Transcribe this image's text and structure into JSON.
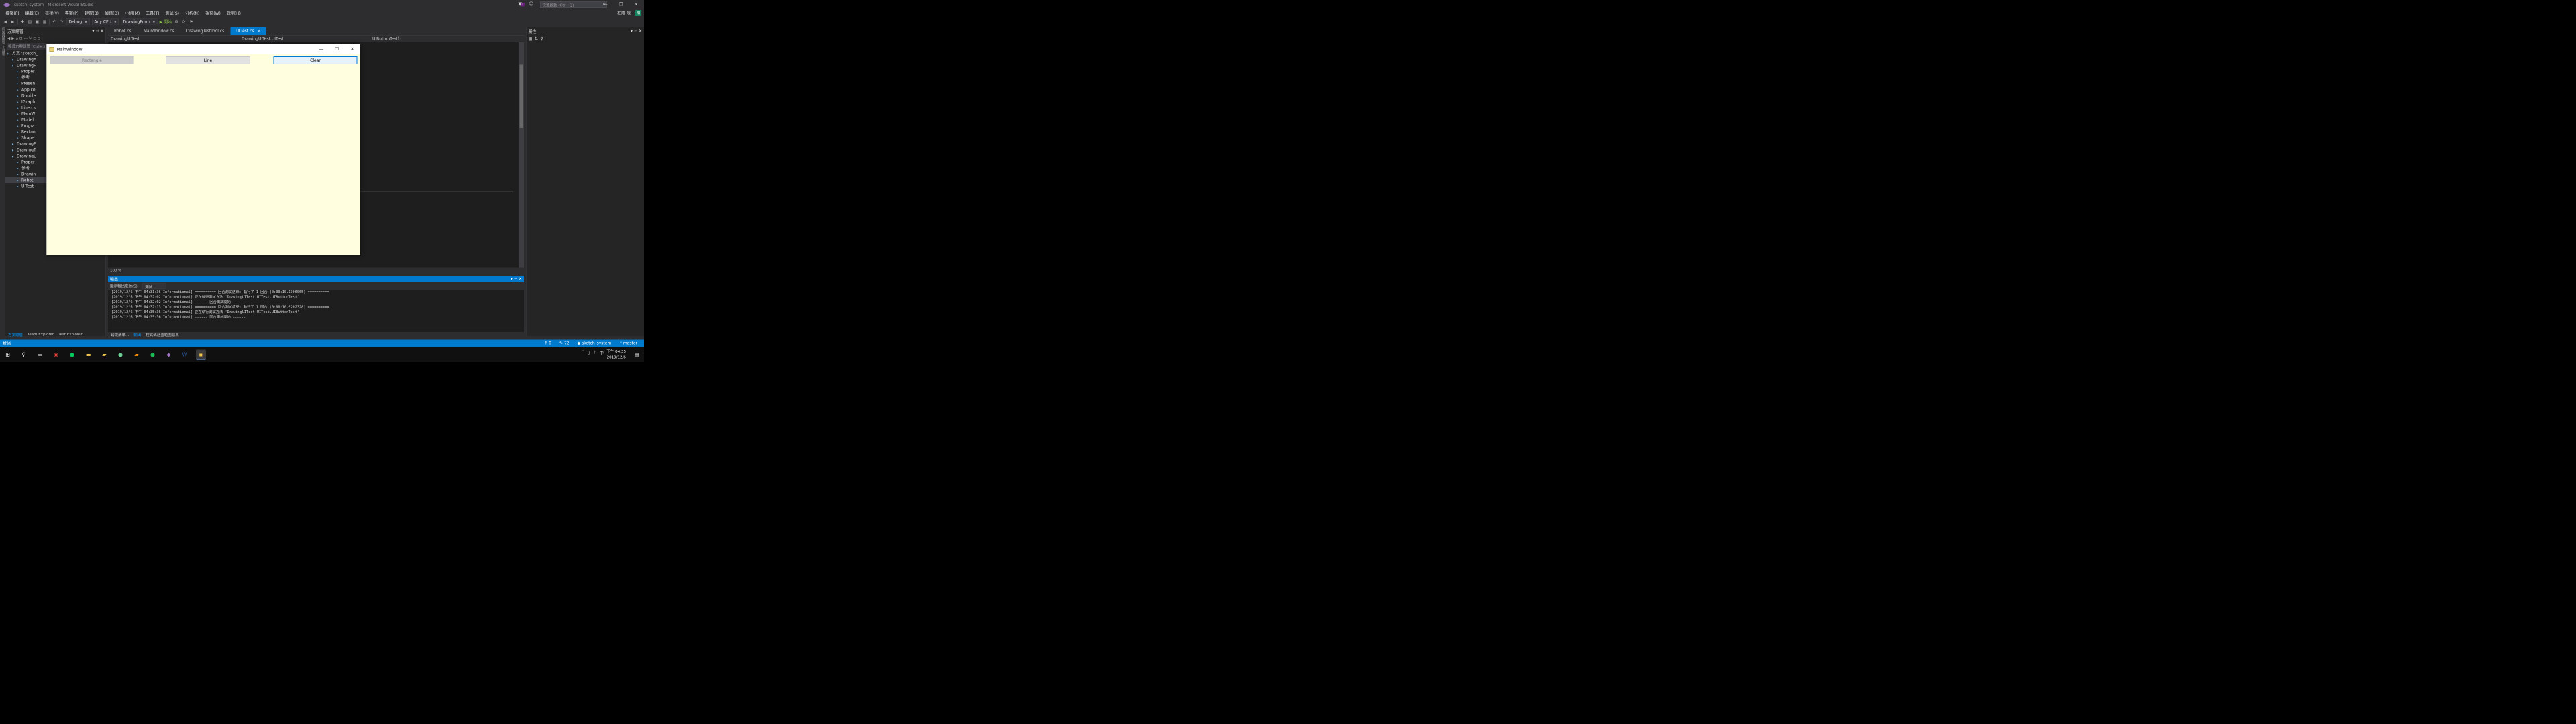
{
  "titlebar": {
    "title": "sketch_system - Microsoft Visual Studio",
    "search_placeholder": "快速啟動 (Ctrl+Q)",
    "notif_count": "1",
    "minimize": "—",
    "restore": "❐",
    "close": "✕"
  },
  "menus": [
    "檔案(F)",
    "編輯(E)",
    "檢視(V)",
    "專案(P)",
    "建置(B)",
    "偵錯(D)",
    "小組(M)",
    "工具(T)",
    "測試(S)",
    "分析(N)",
    "視窗(W)",
    "說明(H)"
  ],
  "user": {
    "name": "柏隆 陳",
    "initials": "柏"
  },
  "toolbar": {
    "config": "Debug",
    "platform": "Any CPU",
    "project": "DrawingForm",
    "start": "▶ 開始"
  },
  "left_strip": "伺服器總管 工具箱",
  "solution_explorer": {
    "title": "方案總管",
    "search_placeholder": "搜尋方案總管 (Ctrl+;)",
    "items": [
      {
        "label": "方案 'sketch_",
        "indent": 0
      },
      {
        "label": "DrawingA",
        "indent": 1
      },
      {
        "label": "DrawingF",
        "indent": 1
      },
      {
        "label": "Proper",
        "indent": 2
      },
      {
        "label": "參考",
        "indent": 2
      },
      {
        "label": "Presen",
        "indent": 2
      },
      {
        "label": "App.co",
        "indent": 2
      },
      {
        "label": "Double",
        "indent": 2
      },
      {
        "label": "IGraph",
        "indent": 2
      },
      {
        "label": "Line.cs",
        "indent": 2
      },
      {
        "label": "MainW",
        "indent": 2
      },
      {
        "label": "Model",
        "indent": 2
      },
      {
        "label": "Progra",
        "indent": 2
      },
      {
        "label": "Rectan",
        "indent": 2
      },
      {
        "label": "Shape",
        "indent": 2
      },
      {
        "label": "DrawingF",
        "indent": 1
      },
      {
        "label": "DrawingT",
        "indent": 1
      },
      {
        "label": "DrawingU",
        "indent": 1
      },
      {
        "label": "Proper",
        "indent": 2
      },
      {
        "label": "參考",
        "indent": 2
      },
      {
        "label": "Drawin",
        "indent": 2
      },
      {
        "label": "Robot",
        "indent": 2,
        "selected": true
      },
      {
        "label": "UITest",
        "indent": 2
      }
    ],
    "tabs": [
      "方案總管",
      "Team Explorer",
      "Test Explorer"
    ]
  },
  "editor": {
    "tabs": [
      {
        "label": "Robot.cs"
      },
      {
        "label": "MainWindow.cs"
      },
      {
        "label": "DrawingTestTool.cs"
      },
      {
        "label": "UITest.cs",
        "active": true
      }
    ],
    "tab_close": "✕",
    "nav_class": "DrawingUITest.UITest",
    "nav_method": "UIButtonTest()",
    "nav_project": "DrawingUITest",
    "line_number": "55",
    "line_text": "}",
    "zoom": "100 %",
    "scroll_thumb_position": 0.1,
    "scroll_thumb_size": 0.28
  },
  "output": {
    "title": "輸出",
    "source_label": "顯示輸出來源(S):",
    "source_value": "測試",
    "lines": [
      "[2019/12/6 下午 04:31:36 Informational] ========== 回合測試結束: 執行了 1 回合 (0:00:10.1306065) ==========",
      "[2019/12/6 下午 04:32:02 Informational] 正在執行測試方法 'DrawingUITest.UITest.UIButtonTest'",
      "[2019/12/6 下午 04:32:02 Informational] ------ 回合測試開始 ------",
      "[2019/12/6 下午 04:32:13 Informational] ========== 回合測試結束: 執行了 1 回合 (0:00:10.9202328) ==========",
      "[2019/12/6 下午 04:35:36 Informational] 正在執行測試方法 'DrawingUITest.UITest.UIButtonTest'",
      "[2019/12/6 下午 04:35:36 Informational] ------ 回合測試開始 ------"
    ],
    "tabs": [
      "錯誤清單...",
      "輸出",
      "程式碼涵蓋範圍結果"
    ]
  },
  "properties": {
    "title": "屬性"
  },
  "statusbar": {
    "left": "就緒",
    "errors": "0",
    "changes": "72",
    "repo": "sketch_system",
    "branch": "master"
  },
  "taskbar": {
    "time": "下午 04:35",
    "date": "2019/12/6",
    "lang": "中"
  },
  "main_window": {
    "title": "MainWindow",
    "buttons": {
      "rectangle": "Rectangle",
      "line": "Line",
      "clear": "Clear"
    },
    "canvas_color": "#ffffe0"
  },
  "colors": {
    "accent": "#007acc",
    "ide_bg": "#2d2d30",
    "editor_bg": "#1e1e1e"
  }
}
